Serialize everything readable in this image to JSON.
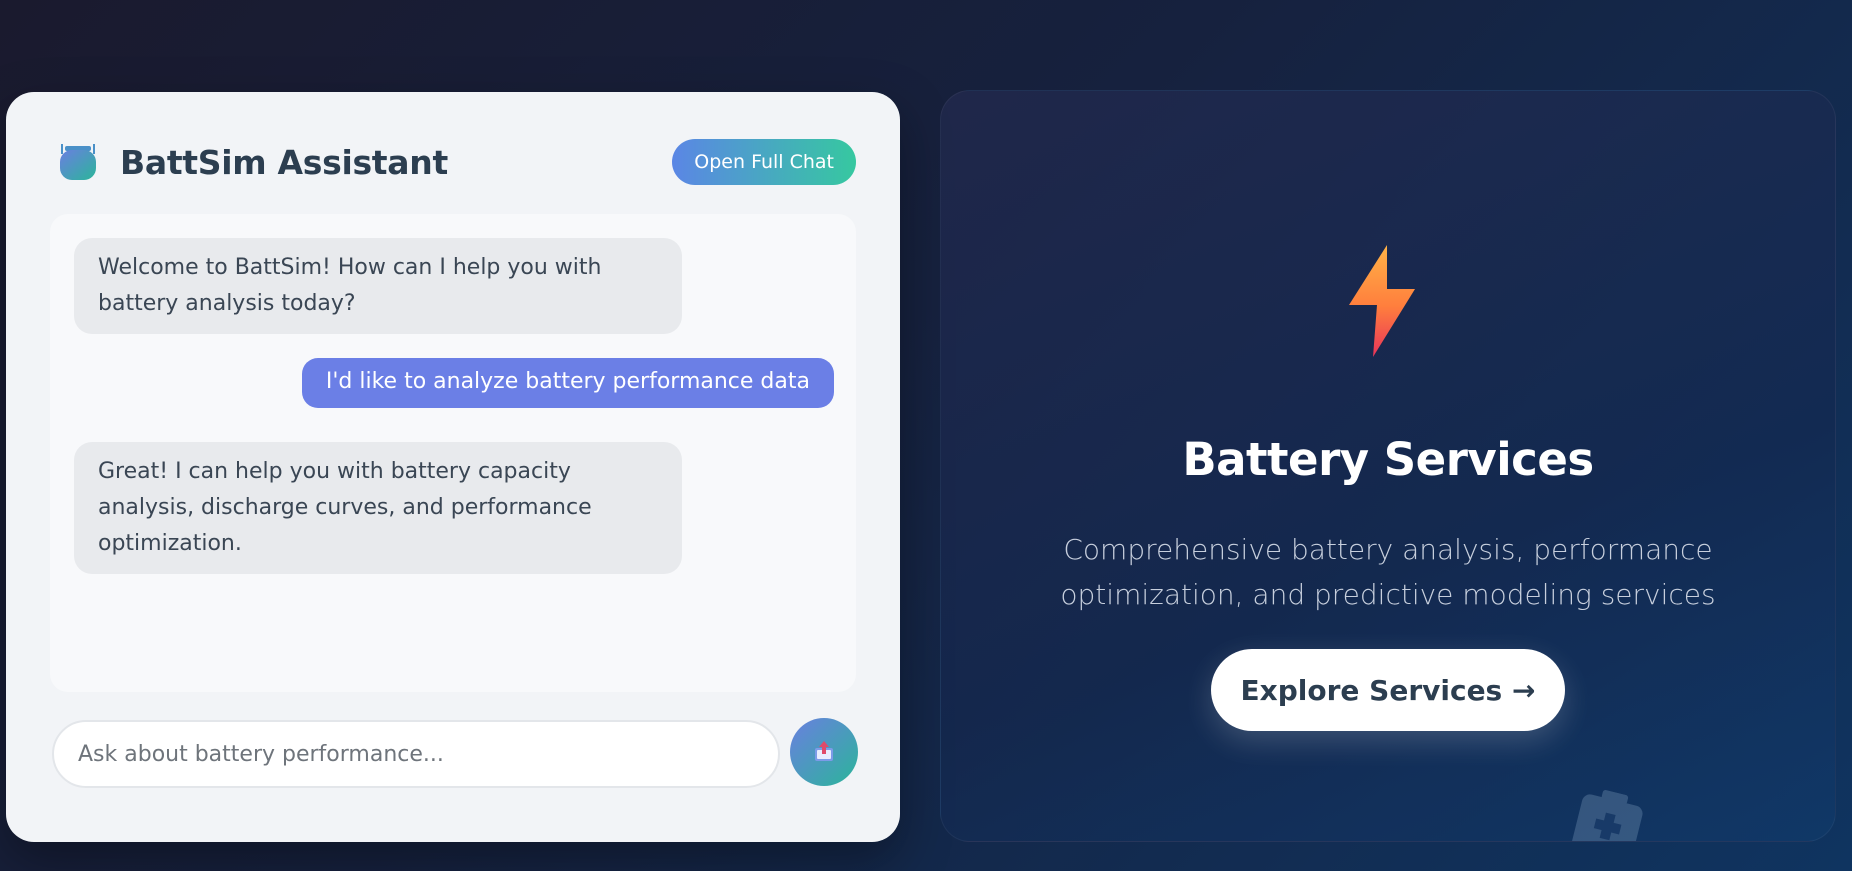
{
  "chat": {
    "title": "BattSim Assistant",
    "open_full_chat_label": "Open Full Chat",
    "messages": [
      {
        "role": "bot",
        "text": "Welcome to BattSim! How can I help you with battery analysis today?"
      },
      {
        "role": "user",
        "text": "I'd like to analyze battery performance data"
      },
      {
        "role": "bot",
        "text": "Great! I can help you with battery capacity analysis, discharge curves, and performance optimization."
      }
    ],
    "input_placeholder": "Ask about battery performance...",
    "input_value": "",
    "send_icon": "send-icon"
  },
  "services": {
    "icon": "lightning-bolt-icon",
    "title": "Battery Services",
    "description": "Comprehensive battery analysis, performance optimization, and predictive modeling services",
    "explore_label": "Explore Services →",
    "decor_icon": "battery-icon"
  },
  "colors": {
    "accent_start": "#5b86e5",
    "accent_end": "#36c8a0",
    "user_bubble": "#6b7fe6",
    "bot_bubble": "#e8eaed",
    "title_text": "#2c3e50"
  }
}
